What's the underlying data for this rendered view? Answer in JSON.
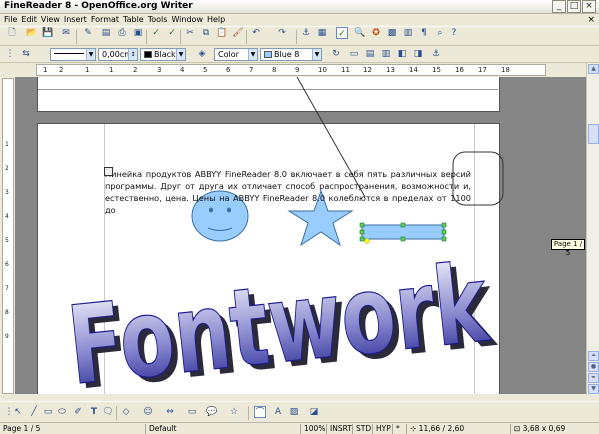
{
  "window": {
    "title": "FineReader 8 - OpenOffice.org Writer"
  },
  "menu": {
    "items": [
      "File",
      "Edit",
      "View",
      "Insert",
      "Format",
      "Table",
      "Tools",
      "Window",
      "Help"
    ]
  },
  "formatting_toolbar": {
    "line_width": "0,00cm",
    "line_color": "Black",
    "area_style": "Color",
    "area_color": "Blue 8"
  },
  "ruler": {
    "ticks": [
      "1",
      "2",
      "1",
      "1",
      "2",
      "3",
      "4",
      "5",
      "6",
      "7",
      "8",
      "9",
      "10",
      "11",
      "12",
      "13",
      "14",
      "15",
      "16",
      "17",
      "18"
    ]
  },
  "vertical_ruler": {
    "ticks": [
      "1",
      "2",
      "3",
      "4",
      "5",
      "6",
      "7",
      "8",
      "9"
    ]
  },
  "document": {
    "paragraph": "Линейка продуктов ABBYY FineReader 8.0 включает в себя пять различных версий программы. Друг от друга их отличает способ распространения, возможности и, естественно, цена. Цены на ABBYY FineReader 8.0 колеблются в пределах от 1100 до",
    "fontwork_text": "Fontwork"
  },
  "page_tooltip": "Page 1 / 5",
  "status": {
    "page": "Page 1 / 5",
    "style": "Default",
    "zoom": "100%",
    "insert_mode": "INSRT",
    "selection_mode": "STD",
    "hyperlink_mode": "HYP",
    "modified": "*",
    "position": "11,66 / 2,60",
    "size": "3,68 x 0,69"
  },
  "colors": {
    "fontwork_dark": "#1a1a8c",
    "fontwork_light": "#ffffff",
    "shape_fill": "#99ccff",
    "shape_stroke": "#3a6ea5"
  }
}
